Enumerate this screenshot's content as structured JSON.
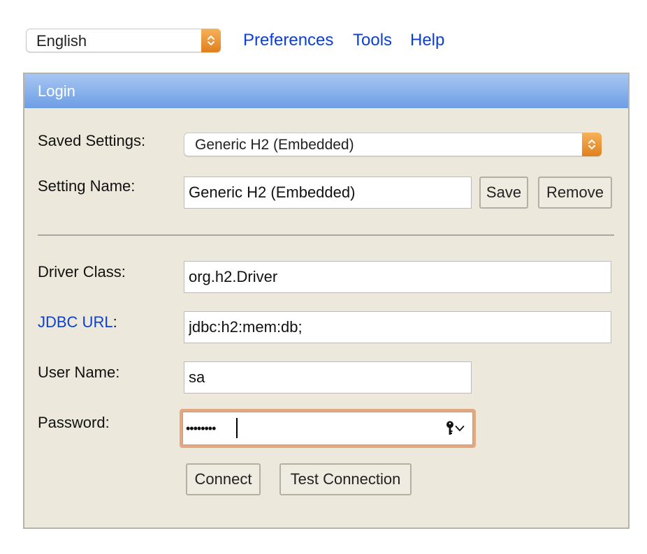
{
  "topbar": {
    "language": {
      "selected": "English"
    },
    "links": [
      {
        "label": "Preferences"
      },
      {
        "label": "Tools"
      },
      {
        "label": "Help"
      }
    ]
  },
  "login": {
    "title": "Login",
    "saved_settings": {
      "label": "Saved Settings:",
      "selected": "Generic H2 (Embedded)"
    },
    "setting_name": {
      "label": "Setting Name:",
      "value": "Generic H2 (Embedded)",
      "save_label": "Save",
      "remove_label": "Remove"
    },
    "driver_class": {
      "label": "Driver Class:",
      "value": "org.h2.Driver"
    },
    "jdbc_url": {
      "label_link": "JDBC URL",
      "label_suffix": ":",
      "value": "jdbc:h2:mem:db;"
    },
    "user_name": {
      "label": "User Name:",
      "value": "sa"
    },
    "password": {
      "label": "Password:",
      "masked_value": "••••••••"
    },
    "connect_label": "Connect",
    "test_connection_label": "Test Connection"
  },
  "colors": {
    "link": "#0b3fd6",
    "header_gradient_top": "#a8c6f2",
    "header_gradient_bottom": "#6c9ee6",
    "panel_background": "#ece9dc",
    "stepper_orange": "#e07f1d",
    "focus_ring": "#e4a880"
  },
  "icons": {
    "select_stepper": "chevron-up-down-icon",
    "password_manager": "key-icon",
    "password_dropdown": "chevron-down-icon"
  }
}
